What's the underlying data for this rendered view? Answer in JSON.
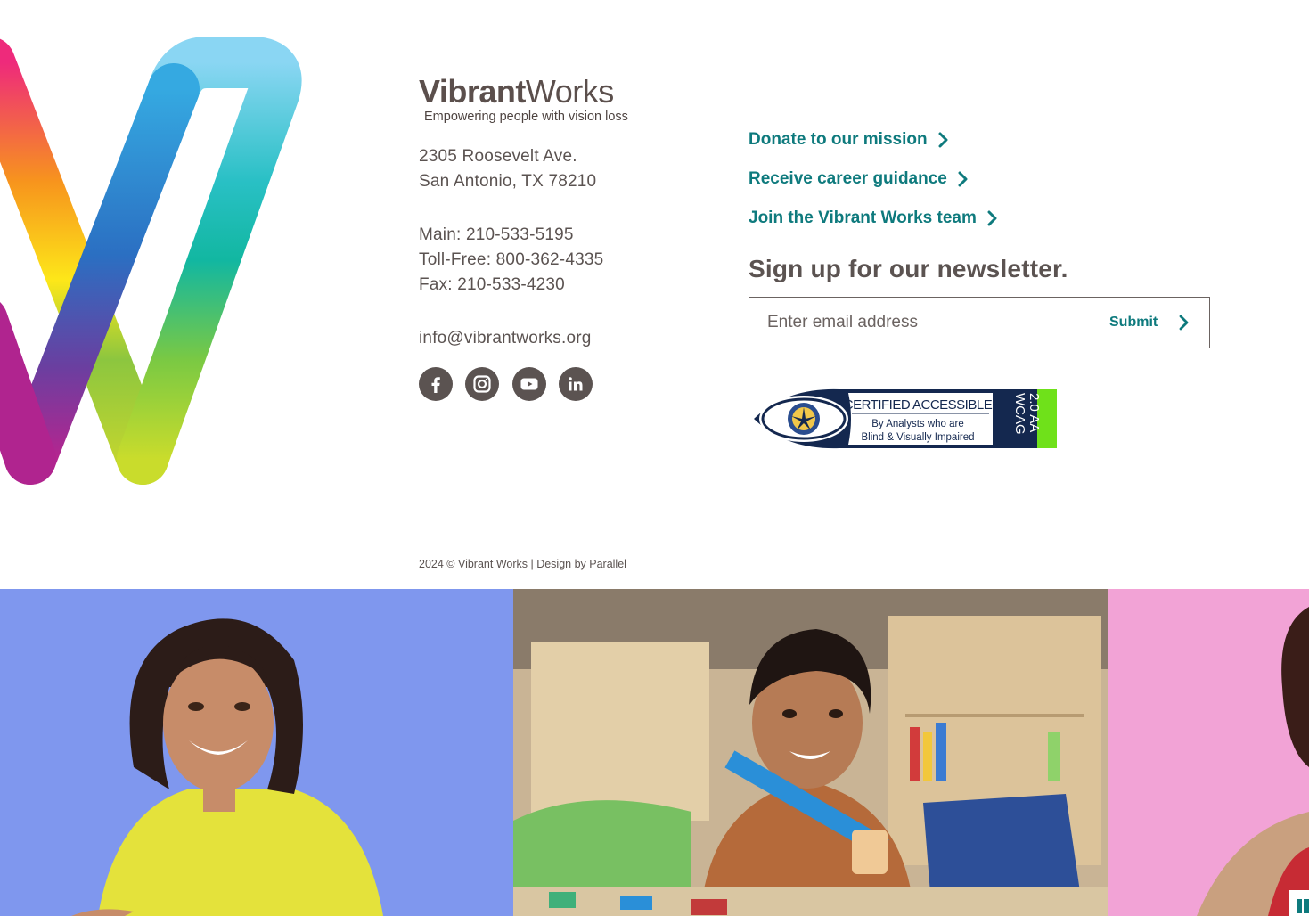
{
  "brand": {
    "name_bold": "Vibrant",
    "name_light": "Works",
    "tagline": "Empowering people with vision loss"
  },
  "address": {
    "line1": "2305 Roosevelt Ave.",
    "line2": "San Antonio, TX 78210"
  },
  "contact": {
    "main": "Main: 210-533-5195",
    "tollfree": "Toll-Free: 800-362-4335",
    "fax": "Fax: 210-533-4230",
    "email": "info@vibrantworks.org"
  },
  "social": [
    {
      "name": "facebook-icon"
    },
    {
      "name": "instagram-icon"
    },
    {
      "name": "youtube-icon"
    },
    {
      "name": "linkedin-icon"
    }
  ],
  "links": {
    "donate": "Donate to our mission",
    "career": "Receive career guidance",
    "team": "Join the Vibrant Works team"
  },
  "newsletter": {
    "title": "Sign up for our newsletter.",
    "placeholder": "Enter email address",
    "value": "",
    "submit": "Submit"
  },
  "badge": {
    "line1": "CERTIFIED ACCESSIBLE",
    "line2": "By Analysts who are",
    "line3": "Blind & Visually Impaired",
    "wcag1": "WCAG",
    "wcag2": "2.0 AA"
  },
  "footer": {
    "copyright": "2024 © Vibrant Works | Design by Parallel"
  },
  "colors": {
    "accent": "#0e7a7d",
    "text": "#5b5351",
    "photo1_bg": "#7f97ee",
    "photo3_bg": "#f2a3d6"
  }
}
